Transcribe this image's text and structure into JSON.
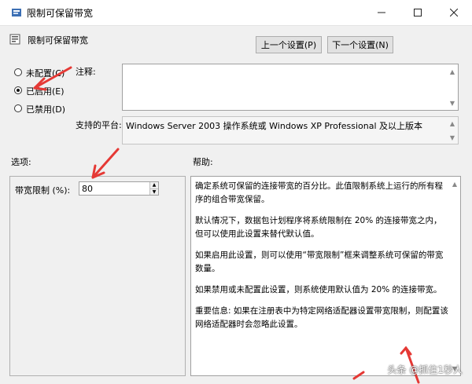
{
  "window": {
    "title": "限制可保留带宽"
  },
  "header": {
    "policy_name": "限制可保留带宽",
    "prev_button": "上一个设置(P)",
    "next_button": "下一个设置(N)"
  },
  "state": {
    "options": [
      {
        "label": "未配置(C)",
        "selected": false
      },
      {
        "label": "已启用(E)",
        "selected": true
      },
      {
        "label": "已禁用(D)",
        "selected": false
      }
    ]
  },
  "comment": {
    "label": "注释:",
    "value": ""
  },
  "platform": {
    "label": "支持的平台:",
    "value": "Windows Server 2003 操作系统或 Windows XP Professional 及以上版本"
  },
  "options_section": {
    "title": "选项:",
    "bandwidth_label": "带宽限制 (%):",
    "bandwidth_value": "80"
  },
  "help_section": {
    "title": "帮助:",
    "paragraphs": [
      "确定系统可保留的连接带宽的百分比。此值限制系统上运行的所有程序的组合带宽保留。",
      "默认情况下，数据包计划程序将系统限制在 20% 的连接带宽之内，但可以使用此设置来替代默认值。",
      "如果启用此设置，则可以使用“带宽限制”框来调整系统可保留的带宽数量。",
      "如果禁用或未配置此设置，则系统使用默认值为 20% 的连接带宽。",
      "重要信息: 如果在注册表中为特定网络适配器设置带宽限制，则配置该网络适配器时会忽略此设置。"
    ]
  },
  "watermark": {
    "text": "头条 @抓住1秒人"
  },
  "colors": {
    "annotation_arrow": "#e53935",
    "title_bg": "#ffffff",
    "dialog_bg": "#f0f0f0"
  }
}
